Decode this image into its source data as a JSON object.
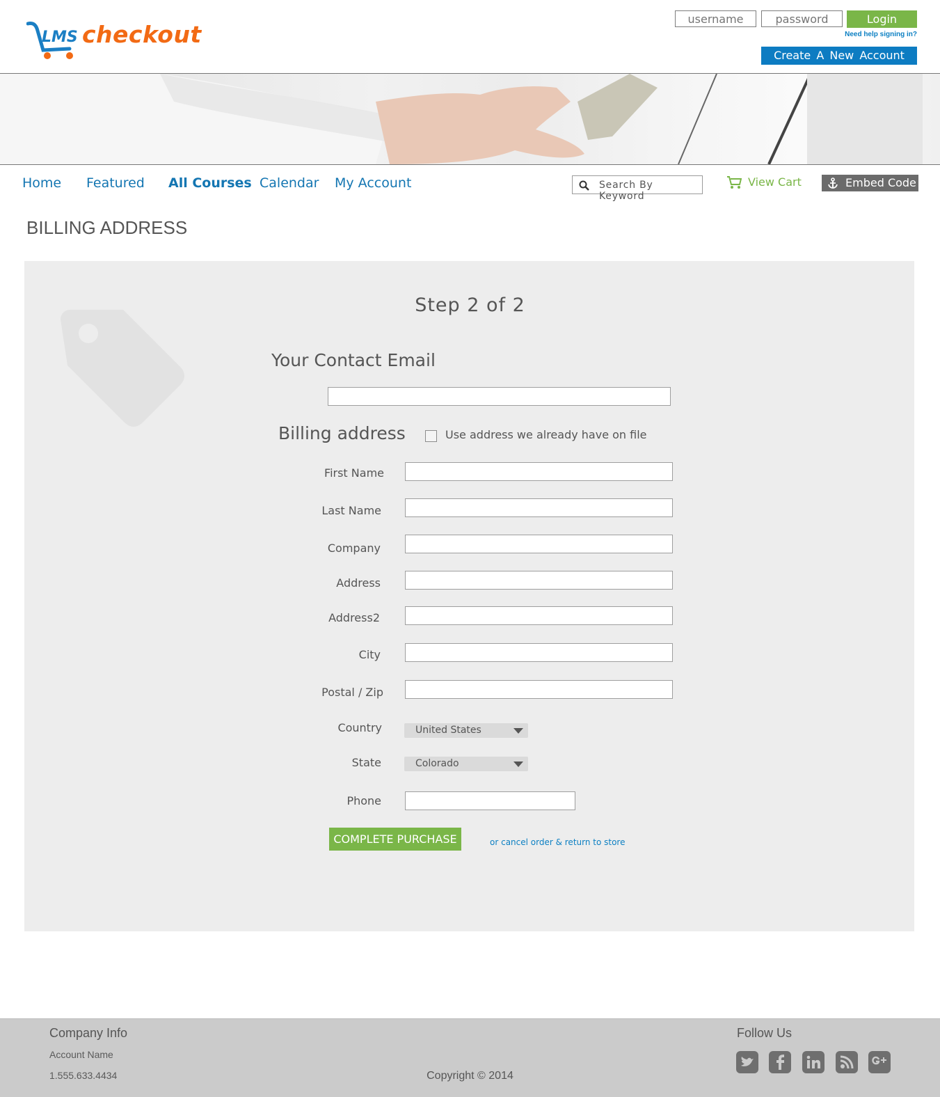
{
  "brand": {
    "name": "checkout",
    "mark": "LMS"
  },
  "auth": {
    "username_placeholder": "username",
    "password_placeholder": "password",
    "login_label": "Login",
    "help_text": "Need help signing in?",
    "create_label": "Create  A  New  Account"
  },
  "nav": {
    "items": [
      {
        "label": "Home"
      },
      {
        "label": "Featured"
      },
      {
        "label": "All Courses",
        "active": true
      },
      {
        "label": "Calendar"
      },
      {
        "label": "My Account"
      }
    ],
    "search_placeholder": "Search By Keyword",
    "view_cart": "View Cart",
    "embed_code": "Embed Code"
  },
  "page": {
    "title": "BILLING ADDRESS"
  },
  "form": {
    "step": "Step 2 of 2",
    "email_heading": "Your Contact Email",
    "email_value": "",
    "billing_heading": "Billing address",
    "use_on_file_label": "Use address we already have on file",
    "use_on_file_checked": false,
    "fields": [
      {
        "label": "First Name",
        "value": ""
      },
      {
        "label": "Last Name",
        "value": ""
      },
      {
        "label": "Company",
        "value": ""
      },
      {
        "label": "Address",
        "value": ""
      },
      {
        "label": "Address2",
        "value": ""
      },
      {
        "label": "City",
        "value": ""
      },
      {
        "label": "Postal / Zip",
        "value": ""
      }
    ],
    "country": {
      "label": "Country",
      "value": "United States"
    },
    "state": {
      "label": "State",
      "value": "Colorado"
    },
    "phone": {
      "label": "Phone",
      "value": ""
    },
    "submit_label": "COMPLETE PURCHASE",
    "cancel_label": "or cancel order & return to store"
  },
  "footer": {
    "company_heading": "Company Info",
    "account_name": "Account Name",
    "phone": "1.555.633.4434",
    "copyright": "Copyright © 2014",
    "follow_heading": "Follow Us",
    "social": [
      "twitter-icon",
      "facebook-icon",
      "linkedin-icon",
      "rss-icon",
      "google-plus-icon"
    ]
  },
  "colors": {
    "accent_blue": "#0d7cc2",
    "accent_green": "#7ab648",
    "brand_orange": "#f26a14",
    "panel_gray": "#ededed",
    "footer_gray": "#cbcbcb"
  }
}
